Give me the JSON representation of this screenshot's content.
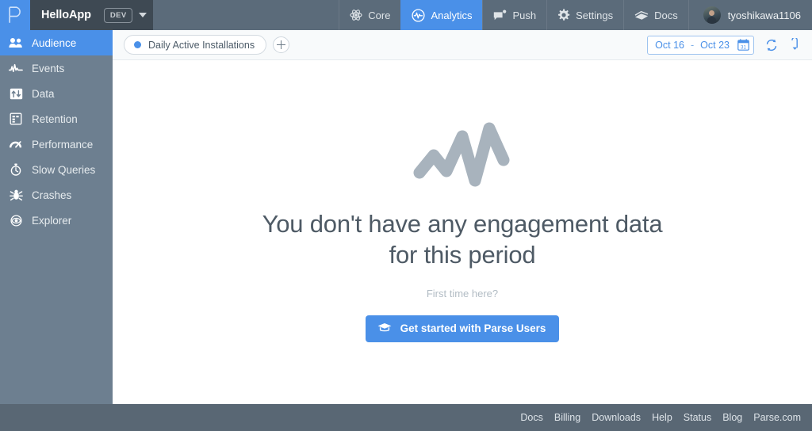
{
  "header": {
    "logo_icon": "parse-p-logo",
    "app_name": "HelloApp",
    "env_badge": "DEV",
    "caret_icon": "chevron-down-icon",
    "tabs": [
      {
        "label": "Core",
        "icon": "atom-icon",
        "active": false
      },
      {
        "label": "Analytics",
        "icon": "pulse-circle-icon",
        "active": true
      },
      {
        "label": "Push",
        "icon": "push-bubble-icon",
        "active": false
      },
      {
        "label": "Settings",
        "icon": "gear-icon",
        "active": false
      },
      {
        "label": "Docs",
        "icon": "book-icon",
        "active": false
      }
    ],
    "user": {
      "name": "tyoshikawa1106",
      "avatar_icon": "user-avatar"
    }
  },
  "sidebar": {
    "items": [
      {
        "label": "Audience",
        "icon": "audience-people-icon",
        "active": true
      },
      {
        "label": "Events",
        "icon": "events-wave-icon",
        "active": false
      },
      {
        "label": "Data",
        "icon": "data-arrows-icon",
        "active": false
      },
      {
        "label": "Retention",
        "icon": "retention-grid-icon",
        "active": false
      },
      {
        "label": "Performance",
        "icon": "performance-gauge-icon",
        "active": false
      },
      {
        "label": "Slow Queries",
        "icon": "stopwatch-icon",
        "active": false
      },
      {
        "label": "Crashes",
        "icon": "bug-icon",
        "active": false
      },
      {
        "label": "Explorer",
        "icon": "eye-icon",
        "active": false
      }
    ]
  },
  "toolbar": {
    "chip": {
      "label": "Daily Active Installations",
      "dot_color": "#4a90e8"
    },
    "add_button_icon": "plus-icon",
    "date_range": {
      "start": "Oct 16",
      "separator": "-",
      "end": "Oct 23",
      "calendar_icon": "calendar-icon"
    },
    "refresh_icon": "refresh-icon",
    "download_icon": "download-icon"
  },
  "empty_state": {
    "glyph_icon": "zigzag-chart-icon",
    "title_line1": "You don't have any engagement data",
    "title_line2": "for this period",
    "subtitle": "First time here?",
    "cta_label": "Get started with Parse Users",
    "cta_icon": "graduation-cap-icon"
  },
  "footer": {
    "links": [
      "Docs",
      "Billing",
      "Downloads",
      "Help",
      "Status",
      "Blog",
      "Parse.com"
    ]
  },
  "colors": {
    "accent": "#4a90e8",
    "header_left_bg": "#3e4953",
    "header_bg": "#5b6b7a",
    "sidebar_bg": "#6d7f90",
    "footer_bg": "#596774",
    "toolbar_bg": "#f8fafb",
    "empty_text": "#4e5a65",
    "empty_glyph": "#a8b3bd"
  }
}
